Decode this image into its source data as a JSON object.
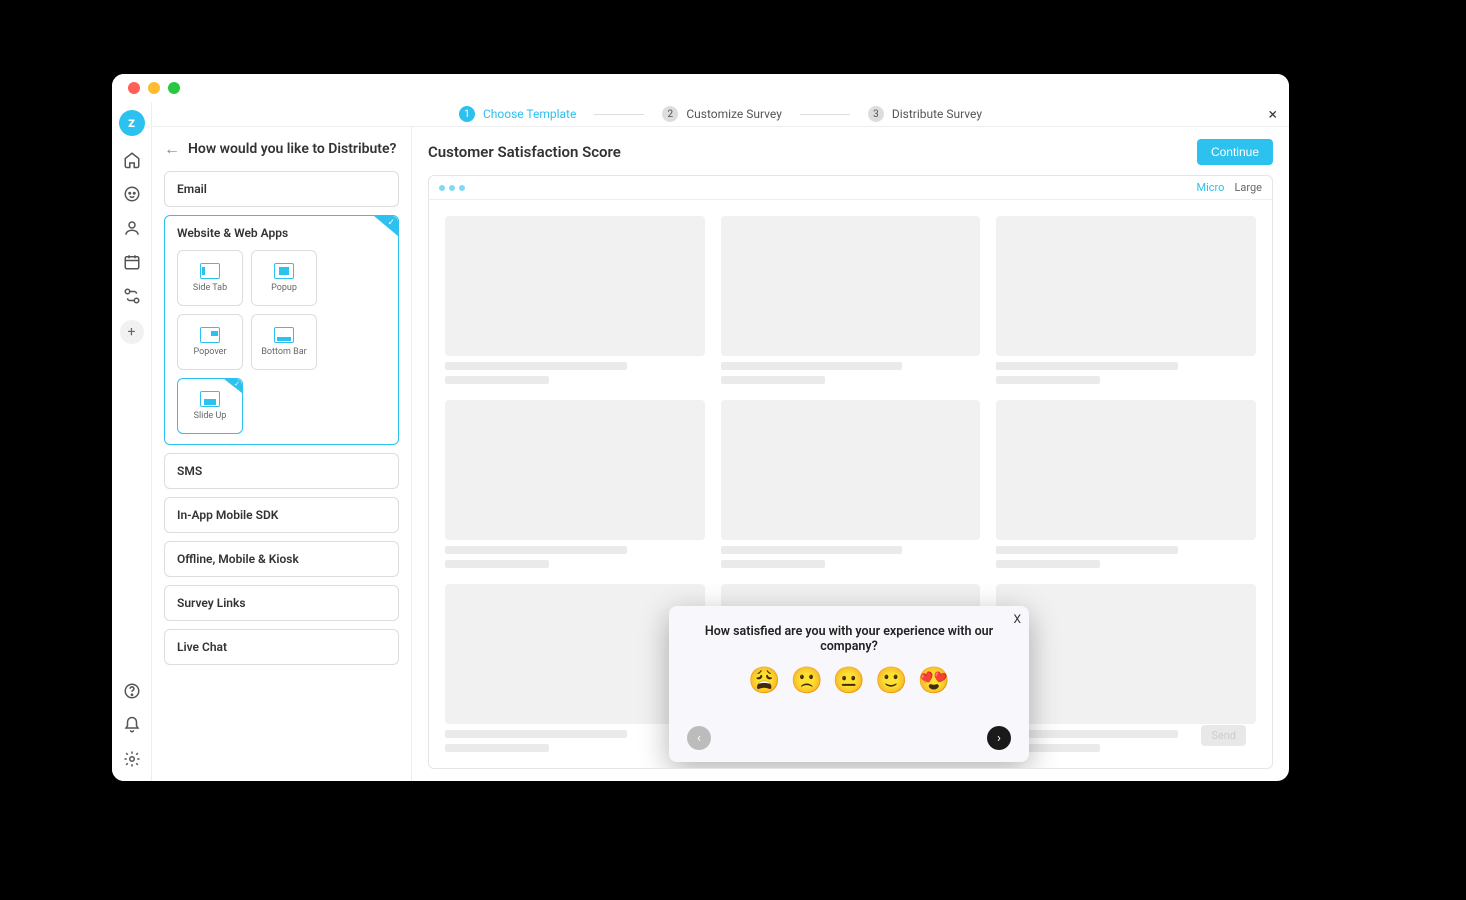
{
  "stepper": {
    "step1": "Choose Template",
    "step2": "Customize Survey",
    "step3": "Distribute Survey"
  },
  "sidebar": {
    "title": "How would you like to Distribute?",
    "channels": {
      "email": "Email",
      "web": "Website & Web Apps",
      "sms": "SMS",
      "sdk": "In-App Mobile SDK",
      "offline": "Offline, Mobile & Kiosk",
      "links": "Survey Links",
      "chat": "Live Chat"
    },
    "subOptions": {
      "sidetab": "Side Tab",
      "popup": "Popup",
      "popover": "Popover",
      "bottombar": "Bottom Bar",
      "slideup": "Slide Up"
    }
  },
  "preview": {
    "title": "Customer Satisfaction Score",
    "continue": "Continue",
    "sizeMicro": "Micro",
    "sizeLarge": "Large"
  },
  "survey": {
    "question": "How satisfied are you with your experience with our company?",
    "emojis": [
      "😩",
      "🙁",
      "😐",
      "🙂",
      "😍"
    ],
    "closeLabel": "X"
  },
  "mock": {
    "sendLabel": "Send"
  }
}
